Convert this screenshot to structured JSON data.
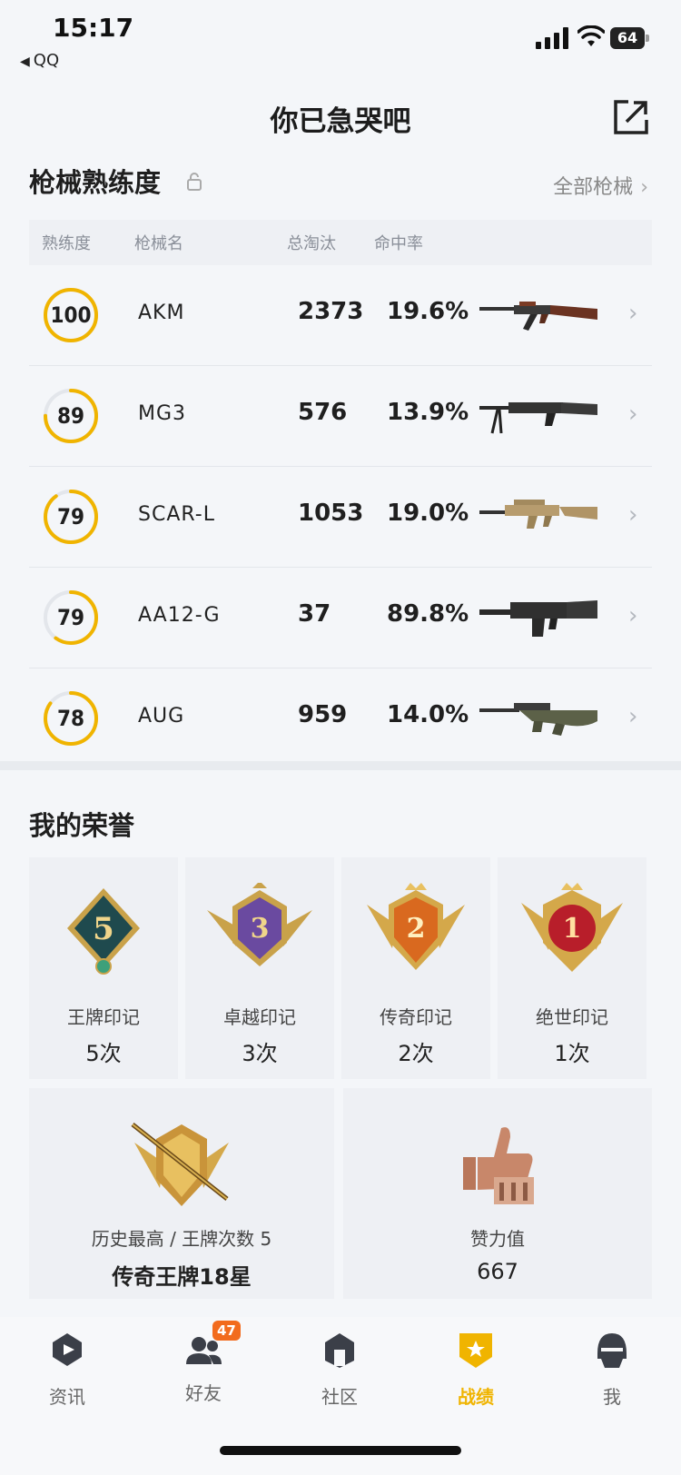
{
  "status": {
    "time": "15:17",
    "back_app": "QQ",
    "battery": "64"
  },
  "header": {
    "title": "你已急哭吧"
  },
  "weapons": {
    "title": "枪械熟练度",
    "all_link": "全部枪械",
    "columns": [
      "熟练度",
      "枪械名",
      "总淘汰",
      "命中率"
    ],
    "rows": [
      {
        "level": "100",
        "level_ratio": 1.0,
        "name": "AKM",
        "kills": "2373",
        "rate": "19.6%",
        "gun_icon": "akm-rifle-icon"
      },
      {
        "level": "89",
        "level_ratio": 0.75,
        "name": "MG3",
        "kills": "576",
        "rate": "13.9%",
        "gun_icon": "mg3-machine-gun-icon"
      },
      {
        "level": "79",
        "level_ratio": 0.9,
        "name": "SCAR-L",
        "kills": "1053",
        "rate": "19.0%",
        "gun_icon": "scar-l-rifle-icon"
      },
      {
        "level": "79",
        "level_ratio": 0.6,
        "name": "AA12-G",
        "kills": "37",
        "rate": "89.8%",
        "gun_icon": "aa12-shotgun-icon"
      },
      {
        "level": "78",
        "level_ratio": 0.85,
        "name": "AUG",
        "kills": "959",
        "rate": "14.0%",
        "gun_icon": "aug-rifle-icon"
      }
    ]
  },
  "honors": {
    "title": "我的荣誉",
    "marks": [
      {
        "badge_text": "5",
        "label": "王牌印记",
        "value": "5次",
        "icon": "ace-mark-badge-icon"
      },
      {
        "badge_text": "3",
        "label": "卓越印记",
        "value": "3次",
        "icon": "excellence-mark-badge-icon"
      },
      {
        "badge_text": "2",
        "label": "传奇印记",
        "value": "2次",
        "icon": "legend-mark-badge-icon"
      },
      {
        "badge_text": "1",
        "label": "绝世印记",
        "value": "1次",
        "icon": "peerless-mark-badge-icon"
      }
    ],
    "history": {
      "label": "历史最高 / 王牌次数 5",
      "value": "传奇王牌18星",
      "icon": "ace-rank-emblem-icon"
    },
    "likes": {
      "label": "赞力值",
      "value": "667",
      "icon": "thumbs-up-trophy-icon"
    }
  },
  "tabs": [
    {
      "label": "资讯",
      "icon": "news-icon",
      "active": false
    },
    {
      "label": "好友",
      "icon": "friends-icon",
      "active": false,
      "badge": "47"
    },
    {
      "label": "社区",
      "icon": "community-icon",
      "active": false
    },
    {
      "label": "战绩",
      "icon": "record-icon",
      "active": true
    },
    {
      "label": "我",
      "icon": "profile-icon",
      "active": false
    }
  ],
  "colors": {
    "accent": "#f0b400",
    "ring_track": "#e3e6eb",
    "badge": "#f26b1d"
  }
}
